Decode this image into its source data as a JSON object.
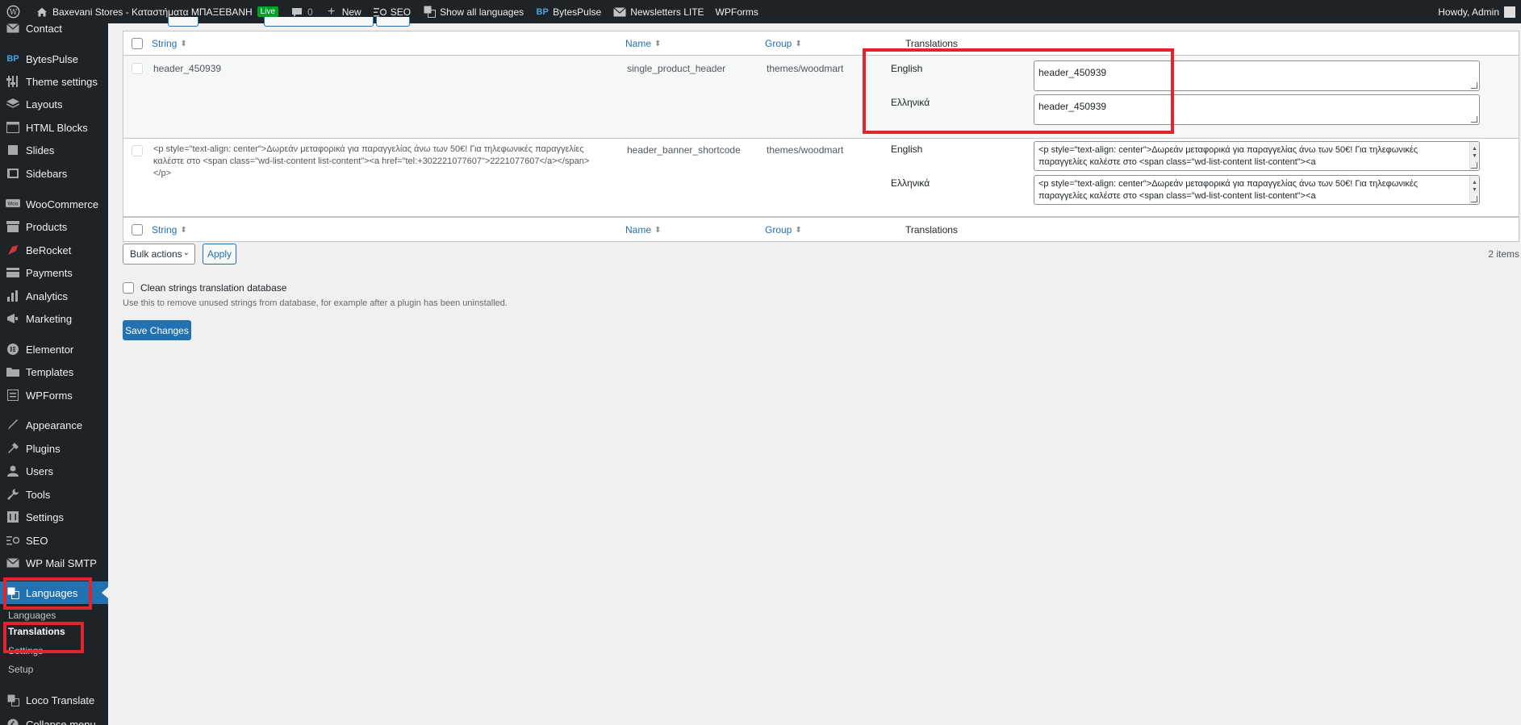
{
  "adminbar": {
    "site_title": "Baxevani Stores - Καταστήματα ΜΠΑΞΕΒΑΝΗ",
    "live_badge": "Live",
    "comments_count": "0",
    "new_label": "New",
    "seo_label": "SEO",
    "show_all_languages": "Show all languages",
    "bytespulse": "BytesPulse",
    "newsletters": "Newsletters LITE",
    "wpforms": "WPForms",
    "howdy": "Howdy, Admin"
  },
  "sidebar": {
    "items": [
      {
        "label": "Contact",
        "icon": "contact-icon"
      },
      {
        "label": "BytesPulse",
        "icon": "bytespulse-icon"
      },
      {
        "label": "Theme settings",
        "icon": "sliders-icon"
      },
      {
        "label": "Layouts",
        "icon": "layers-icon"
      },
      {
        "label": "HTML Blocks",
        "icon": "html-icon"
      },
      {
        "label": "Slides",
        "icon": "slides-icon"
      },
      {
        "label": "Sidebars",
        "icon": "sidebar-icon"
      },
      {
        "label": "WooCommerce",
        "icon": "woo-icon"
      },
      {
        "label": "Products",
        "icon": "archive-icon"
      },
      {
        "label": "BeRocket",
        "icon": "rocket-icon"
      },
      {
        "label": "Payments",
        "icon": "payments-icon"
      },
      {
        "label": "Analytics",
        "icon": "chart-icon"
      },
      {
        "label": "Marketing",
        "icon": "megaphone-icon"
      },
      {
        "label": "Elementor",
        "icon": "elementor-icon"
      },
      {
        "label": "Templates",
        "icon": "folder-icon"
      },
      {
        "label": "WPForms",
        "icon": "form-icon"
      },
      {
        "label": "Appearance",
        "icon": "brush-icon"
      },
      {
        "label": "Plugins",
        "icon": "plugin-icon"
      },
      {
        "label": "Users",
        "icon": "user-icon"
      },
      {
        "label": "Tools",
        "icon": "wrench-icon"
      },
      {
        "label": "Settings",
        "icon": "settings-icon"
      },
      {
        "label": "SEO",
        "icon": "seo-icon"
      },
      {
        "label": "WP Mail SMTP",
        "icon": "mail-icon"
      },
      {
        "label": "Languages",
        "icon": "translation-icon"
      },
      {
        "label": "Loco Translate",
        "icon": "loco-icon"
      },
      {
        "label": "Collapse menu",
        "icon": "collapse-icon"
      }
    ],
    "submenu": [
      "Languages",
      "Translations",
      "Settings",
      "Setup"
    ]
  },
  "table": {
    "headers": {
      "string": "String",
      "name": "Name",
      "group": "Group",
      "translations": "Translations"
    },
    "rows": [
      {
        "string": "header_450939",
        "name": "single_product_header",
        "group": "themes/woodmart",
        "lang1": "English",
        "val1": "header_450939",
        "lang2": "Ελληνικά",
        "val2": "header_450939"
      },
      {
        "string": "<p style=\"text-align: center\">Δωρεάν μεταφορικά για παραγγελίας άνω των 50€! Για τηλεφωνικές παραγγελίες καλέστε στο <span class=\"wd-list-content list-content\"><a href=\"tel:+302221077607\">2221077607</a></span></p>",
        "name": "header_banner_shortcode",
        "group": "themes/woodmart",
        "lang1": "English",
        "val1": "<p style=\"text-align: center\">Δωρεάν μεταφορικά για παραγγελίας άνω των 50€! Για τηλεφωνικές παραγγελίες καλέστε στο <span class=\"wd-list-content list-content\"><a",
        "lang2": "Ελληνικά",
        "val2": "<p style=\"text-align: center\">Δωρεάν μεταφορικά για παραγγελίας άνω των 50€! Για τηλεφωνικές παραγγελίες καλέστε στο <span class=\"wd-list-content list-content\"><a"
      }
    ]
  },
  "bulk_actions": "Bulk actions",
  "apply": "Apply",
  "items_count": "2 items",
  "clean_label": "Clean strings translation database",
  "clean_desc": "Use this to remove unused strings from database, for example after a plugin has been uninstalled.",
  "save_changes": "Save Changes",
  "colors": {
    "accent": "#2271b1",
    "highlight": "#e0262c",
    "sidebar_bg": "#1d2327"
  }
}
